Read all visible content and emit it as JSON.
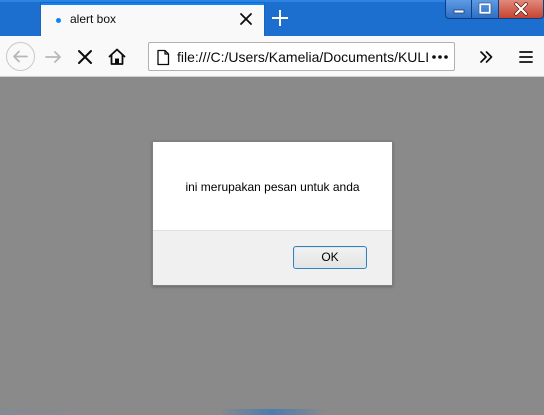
{
  "browser": {
    "tab": {
      "title": "alert box"
    },
    "address_bar": {
      "url": "file:///C:/Users/Kamelia/Documents/KULIAH"
    }
  },
  "icons": {
    "back": "back-arrow-icon",
    "forward": "forward-arrow-icon",
    "stop": "stop-x-icon",
    "home": "home-icon",
    "page": "page-icon",
    "page_actions": "more-dots-icon",
    "overflow": "chevron-double-right-icon",
    "menu": "hamburger-menu-icon",
    "new_tab": "plus-icon",
    "tab_close": "close-icon"
  },
  "alert": {
    "message": "ini merupakan pesan untuk anda",
    "ok_label": "OK"
  },
  "colors": {
    "titlebar": "#1c6fcf",
    "overlay": "#8a8a8a",
    "tab_accent": "#0a84ff",
    "button_border": "#3c7fb1"
  }
}
